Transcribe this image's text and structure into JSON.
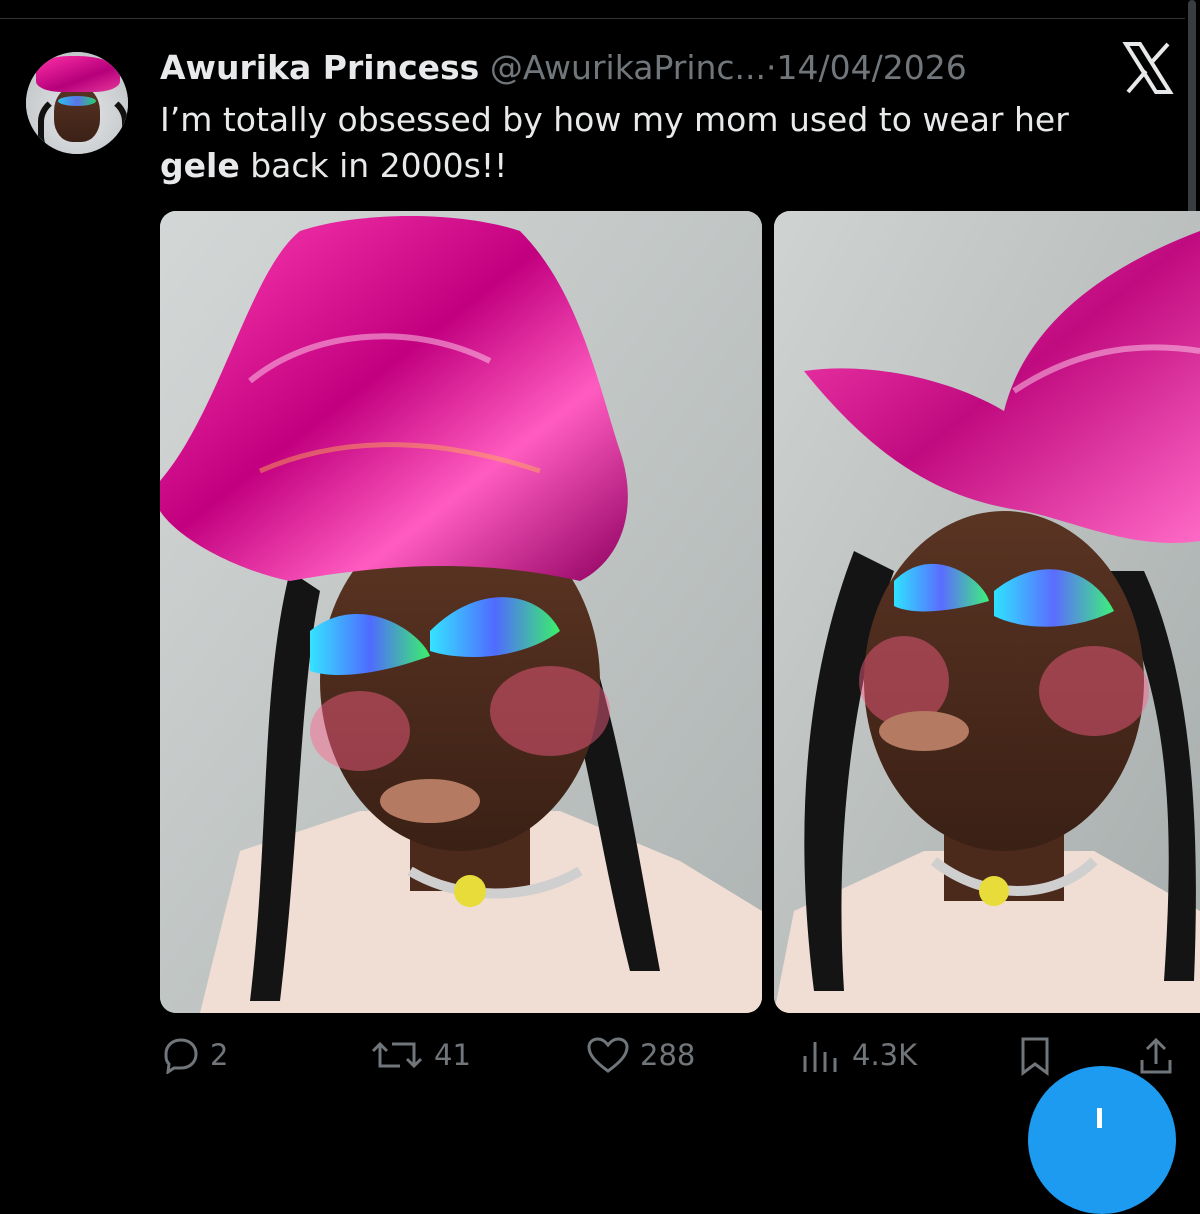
{
  "tweet": {
    "author_name": "Awurika Princess",
    "handle": "@AwurikaPrinc...",
    "separator": "·",
    "date": "14/04/2026",
    "text_part1": "I’m totally obsessed by how my mom used to wear her",
    "text_bold": "gele",
    "text_part2": " back in 2000s!!",
    "images": [
      {
        "description_icon": "photo-icon"
      },
      {
        "description_icon": "photo-icon"
      }
    ]
  },
  "actions": {
    "replies": "2",
    "reposts": "41",
    "likes": "288",
    "views": "4.3K"
  },
  "icons": {
    "reply": "reply-icon",
    "repost": "repost-icon",
    "like": "heart-icon",
    "views": "views-icon",
    "bookmark": "bookmark-icon",
    "share": "share-icon",
    "brand": "x-logo-icon",
    "compose": "compose-plus-icon"
  },
  "colors": {
    "background": "#000000",
    "text_primary": "#e7e9ea",
    "text_secondary": "#71767b",
    "accent": "#1d9bf0"
  }
}
